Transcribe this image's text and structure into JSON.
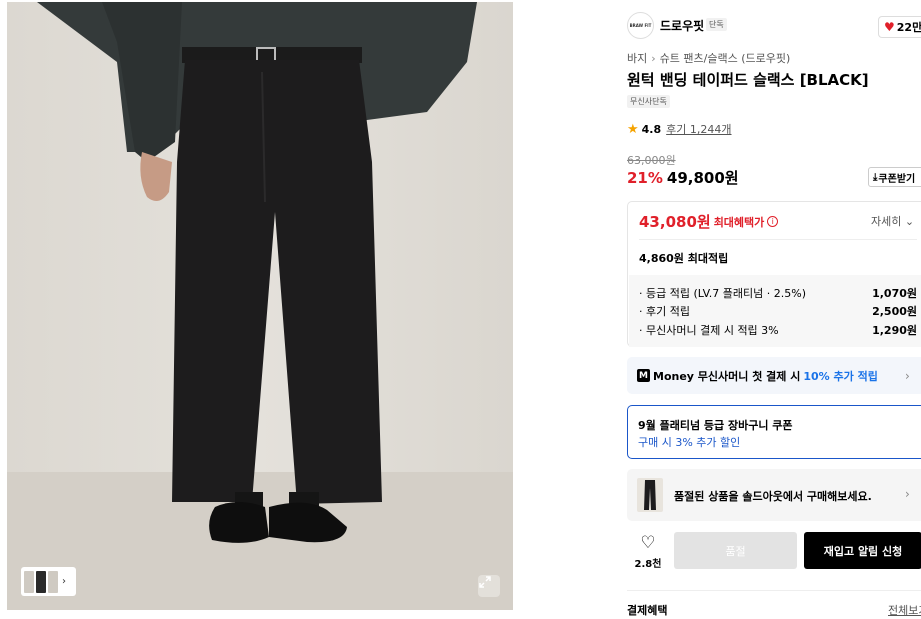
{
  "brand": {
    "logo_text": "BRAW FIT",
    "name": "드로우핏",
    "tag": "단독",
    "likes": "22만"
  },
  "breadcrumb": [
    "바지",
    "슈트 팬츠/슬랙스 (드로우핏)"
  ],
  "product": {
    "title": "원턱 밴딩 테이퍼드 슬랙스 [BLACK]",
    "exclusive_tag": "무신사단독",
    "rating": "4.8",
    "reviews": "후기 1,244개"
  },
  "price": {
    "original": "63,000원",
    "discount": "21%",
    "sale": "49,800원",
    "coupon_button": "쿠폰받기"
  },
  "benefit": {
    "max_price": "43,080원",
    "max_label": "최대혜택가",
    "detail_button": "자세히",
    "points_title": "4,860원 최대적립",
    "points": [
      {
        "label": "· 등급 적립 (LV.7 플래티넘 · 2.5%)",
        "value": "1,070원"
      },
      {
        "label": "· 후기 적립",
        "value": "2,500원"
      },
      {
        "label": "· 무신사머니 결제 시 적립 3%",
        "value": "1,290원"
      }
    ]
  },
  "money_banner": {
    "logo": "M",
    "text": "Money 무신사머니 첫 결제 시",
    "highlight": "10% 추가 적립"
  },
  "coupon_banner": {
    "title": "9월 플래티넘 등급 장바구니 쿠폰",
    "subtitle": "구매 시 3% 추가 할인"
  },
  "soldout_banner": {
    "text": "품절된 상품을 솔드아웃에서 구매해보세요."
  },
  "actions": {
    "wish_count": "2.8천",
    "sold_out_button": "품절",
    "restock_button": "재입고 알림 신청"
  },
  "payment": {
    "title": "결제혜택",
    "view_all": "전체보기"
  },
  "colors": {
    "accent_red": "#e0202a",
    "accent_blue": "#1a56c9",
    "star": "#f5a300"
  }
}
